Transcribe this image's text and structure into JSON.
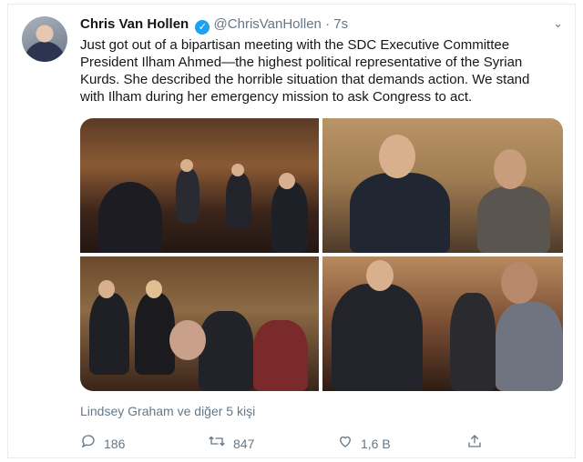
{
  "tweet": {
    "name": "Chris Van Hollen",
    "handle": "@ChrisVanHollen",
    "separator": "·",
    "time": "7s",
    "text": "Just got out of a bipartisan meeting with the SDC Executive Committee President Ilham Ahmed—the highest political representative of the Syrian Kurds. She described the horrible situation that demands action. We stand with Ilham during her emergency mission to ask Congress to act.",
    "liked_by": "Lindsey Graham ve diğer 5 kişi"
  },
  "actions": {
    "reply_count": "186",
    "retweet_count": "847",
    "like_count": "1,6 B"
  },
  "icons": {
    "verified": "verified-badge-icon",
    "more": "chevron-down-icon",
    "reply": "reply-icon",
    "retweet": "retweet-icon",
    "like": "heart-icon",
    "share": "share-icon"
  },
  "colors": {
    "verified": "#1da1f2",
    "secondary_text": "#657786"
  }
}
